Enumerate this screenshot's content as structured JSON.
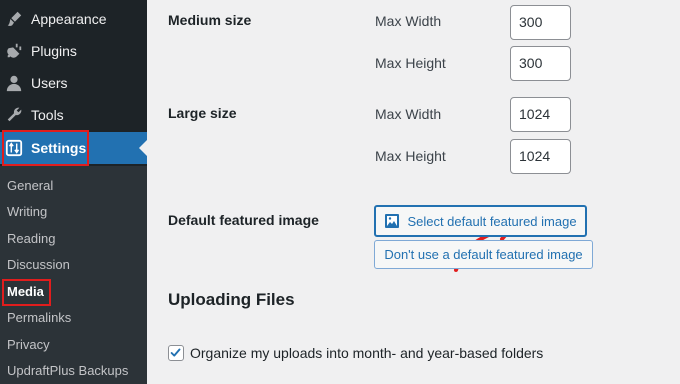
{
  "sidebar": {
    "menu": [
      {
        "label": "Appearance",
        "icon": "paintbrush-icon"
      },
      {
        "label": "Plugins",
        "icon": "plugin-icon"
      },
      {
        "label": "Users",
        "icon": "user-icon"
      },
      {
        "label": "Tools",
        "icon": "wrench-icon"
      },
      {
        "label": "Settings",
        "icon": "settings-icon"
      }
    ],
    "submenu": [
      "General",
      "Writing",
      "Reading",
      "Discussion",
      "Media",
      "Permalinks",
      "Privacy",
      "UpdraftPlus Backups"
    ],
    "current_submenu": "Media",
    "colors": {
      "bg": "#1d2327",
      "active": "#2271b1",
      "highlight_border": "#e11d1d"
    }
  },
  "content": {
    "medium": {
      "label": "Medium size",
      "width_label": "Max Width",
      "width_value": "300",
      "height_label": "Max Height",
      "height_value": "300"
    },
    "large": {
      "label": "Large size",
      "width_label": "Max Width",
      "width_value": "1024",
      "height_label": "Max Height",
      "height_value": "1024"
    },
    "featured": {
      "label": "Default featured image",
      "select_button": "Select default featured image",
      "none_button": "Don't use a default featured image"
    },
    "uploading": {
      "title": "Uploading Files",
      "organize_label": "Organize my uploads into month- and year-based folders",
      "organize_checked": true
    }
  },
  "accent_color": "#2271b1",
  "annotation_color": "#e11d1d"
}
